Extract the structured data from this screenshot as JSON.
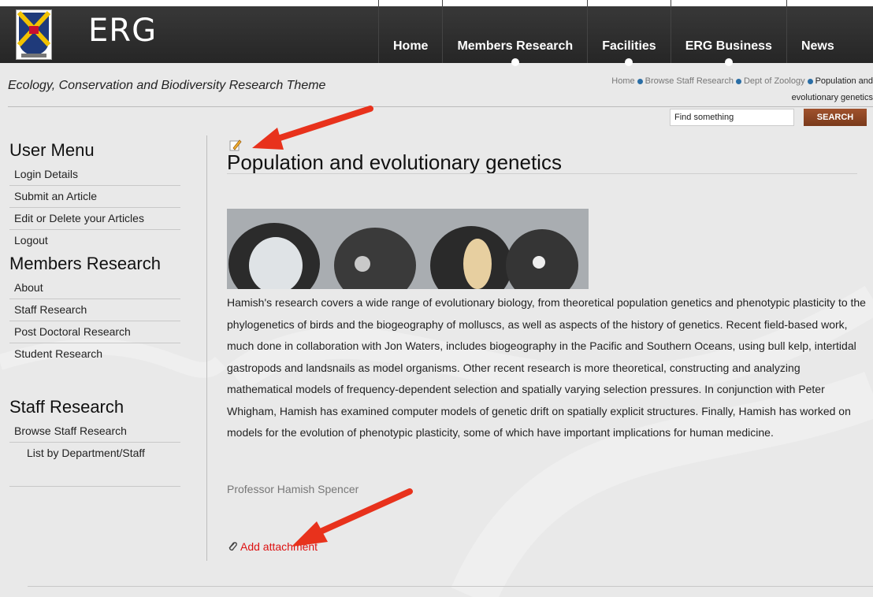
{
  "brand": {
    "name": "ERG"
  },
  "nav": {
    "items": [
      {
        "label": "Home"
      },
      {
        "label": "Members Research"
      },
      {
        "label": "Facilities"
      },
      {
        "label": "ERG Business"
      },
      {
        "label": "News"
      }
    ]
  },
  "theme_title": "Ecology, Conservation and Biodiversity Research Theme",
  "breadcrumb": {
    "items": [
      "Home",
      "Browse Staff Research",
      "Dept of Zoology"
    ],
    "current_line1": "Population and",
    "current_line2": "evolutionary genetics"
  },
  "search": {
    "placeholder": "Find something",
    "value": "Find something",
    "button_label": "SEARCH"
  },
  "sidebar": {
    "user_menu": {
      "heading": "User Menu",
      "links": [
        "Login Details",
        "Submit an Article",
        "Edit or Delete your Articles",
        "Logout"
      ]
    },
    "members_research": {
      "heading": "Members Research",
      "links": [
        "About",
        "Staff Research",
        "Post Doctoral Research",
        "Student Research"
      ]
    },
    "staff_research": {
      "heading": "Staff Research",
      "links": [
        "Browse Staff Research",
        "List by Department/Staff"
      ]
    }
  },
  "article": {
    "title": "Population and evolutionary genetics",
    "body": "Hamish's research covers a wide range of evolutionary biology, from theoretical population genetics and phenotypic plasticity to the phylogenetics of birds and the biogeography of molluscs, as well as aspects of the history of genetics. Recent field-based work, much done in collaboration with Jon Waters, includes biogeography in the Pacific and Southern Oceans, using bull kelp, intertidal gastropods and landsnails as model organisms.  Other recent research is more theoretical, constructing and analyzing mathematical models of frequency-dependent selection and spatially varying selection pressures.  In conjunction with Peter Whigham, Hamish has examined computer models of genetic drift on spatially explicit structures.  Finally, Hamish has worked on models for the evolution of phenotypic plasticity, some of which have important implications for human medicine.",
    "author": "Professor Hamish Spencer",
    "attachment_label": "Add attachment"
  },
  "colors": {
    "header_bg": "#2e2e2e",
    "search_button": "#8b4523",
    "link_red": "#dd1111",
    "breadcrumb_dot": "#2a6ea6",
    "arrow_red": "#e8321c"
  },
  "icons": [
    "crest-logo",
    "edit-icon",
    "paperclip-icon",
    "breadcrumb-dot-icon"
  ]
}
